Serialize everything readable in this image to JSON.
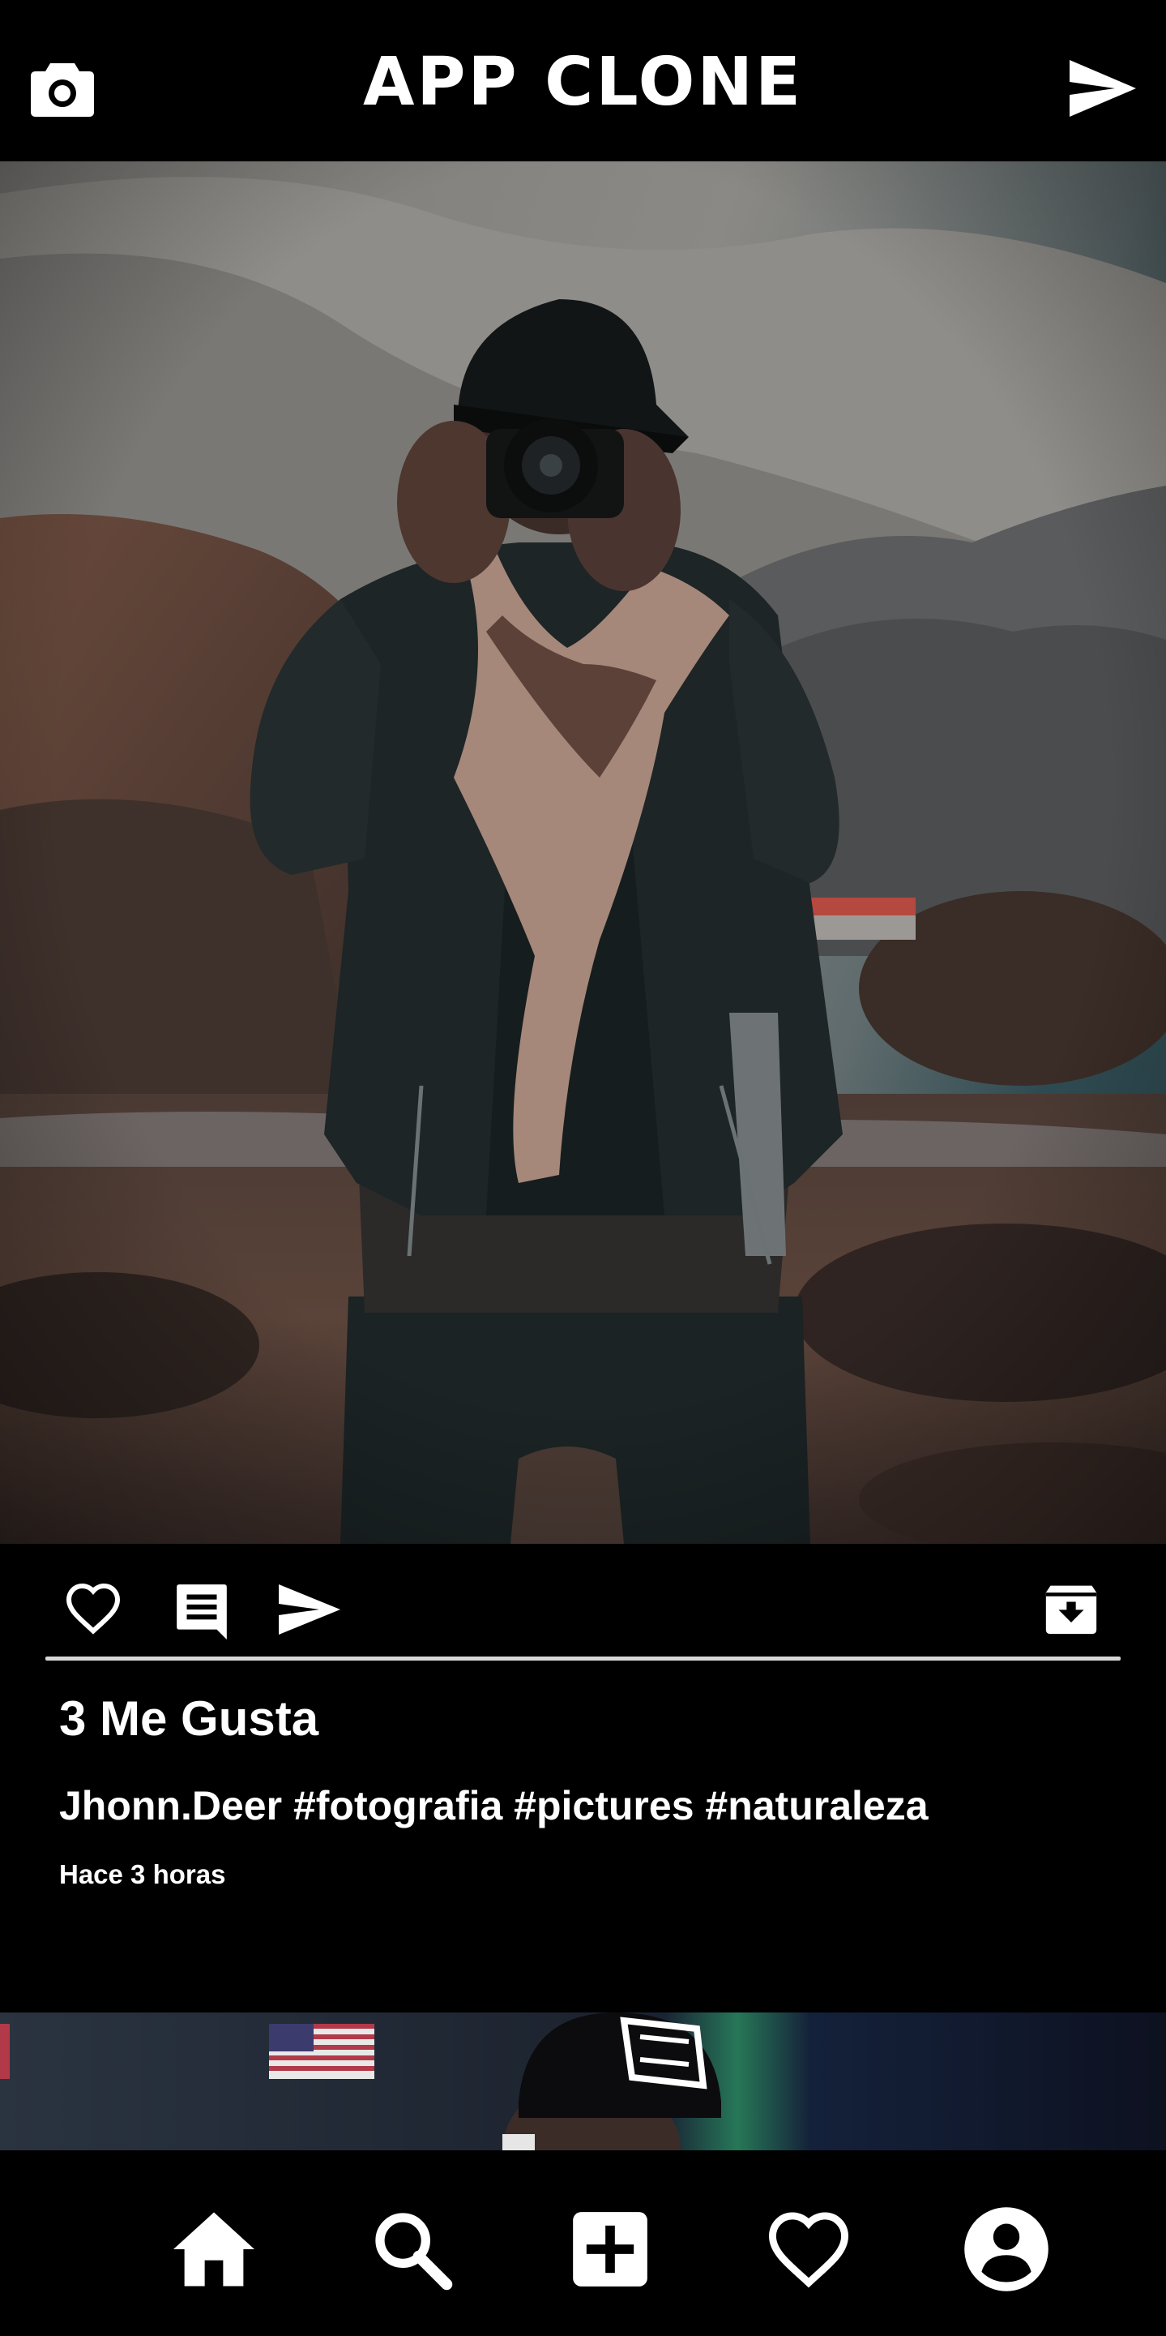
{
  "header": {
    "title": "APP CLONE",
    "left_icon": "camera-icon",
    "right_icon": "send-icon"
  },
  "post": {
    "image_subject": "photographer-in-mountains",
    "actions": {
      "like_icon": "heart-outline-icon",
      "comment_icon": "comment-icon",
      "share_icon": "send-icon",
      "save_icon": "archive-icon"
    },
    "likes_text": "3 Me Gusta",
    "caption": "Jhonn.Deer #fotografia #pictures #naturaleza",
    "time_ago": "Hace 3 horas"
  },
  "bottom_nav": {
    "items": [
      {
        "name": "home",
        "icon": "home-icon"
      },
      {
        "name": "search",
        "icon": "search-icon"
      },
      {
        "name": "add",
        "icon": "add-box-icon"
      },
      {
        "name": "activity",
        "icon": "heart-outline-icon"
      },
      {
        "name": "profile",
        "icon": "account-circle-icon"
      }
    ]
  },
  "colors": {
    "background": "#000000",
    "text": "#ffffff",
    "divider": "#d7d7d7"
  }
}
